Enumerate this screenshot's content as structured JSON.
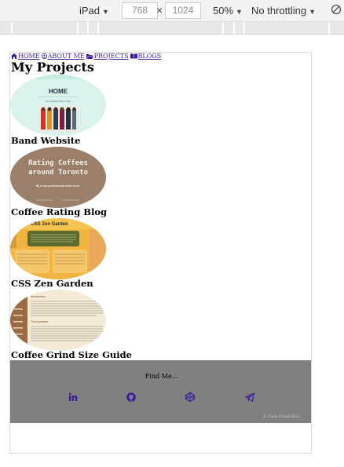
{
  "devtools": {
    "device": "iPad",
    "width_value": "768",
    "height_value": "1024",
    "times": "×",
    "zoom": "50%",
    "throttling": "No throttling"
  },
  "nav": {
    "items": [
      {
        "label": "HOME",
        "icon": "home-icon"
      },
      {
        "label": "ABOUT ME",
        "icon": "user-circle-icon"
      },
      {
        "label": "PROJECTS",
        "icon": "folder-open-icon"
      },
      {
        "label": "BLOGS",
        "icon": "book-open-icon"
      }
    ]
  },
  "page": {
    "title": "My Projects"
  },
  "projects": [
    {
      "label": "Band Website",
      "thumb": {
        "heading": "HOME",
        "subtitle": "The Sobriquets Play 'n Play"
      }
    },
    {
      "label": "Coffee Rating Blog",
      "thumb": {
        "heading_line1": "Rating Coffees",
        "heading_line2": "around Toronto",
        "subtitle": "By a non-professional coffee lover."
      }
    },
    {
      "label": "CSS Zen Garden",
      "thumb": {
        "heading": "CSS Zen Garden"
      }
    },
    {
      "label": "Coffee Grind Size Guide",
      "thumb": {
        "heading": "Introduction",
        "subheading": "The Importance"
      }
    }
  ],
  "footer": {
    "find_me": "Find Me...",
    "icons": [
      "linkedin-icon",
      "github-icon",
      "codepen-icon",
      "telegram-icon"
    ],
    "copyright": "© Clare O'Neil 2021"
  },
  "colors": {
    "nav_link": "#3b1a9a",
    "footer_bg": "#808080",
    "footer_icons": "#3b1a9a"
  }
}
